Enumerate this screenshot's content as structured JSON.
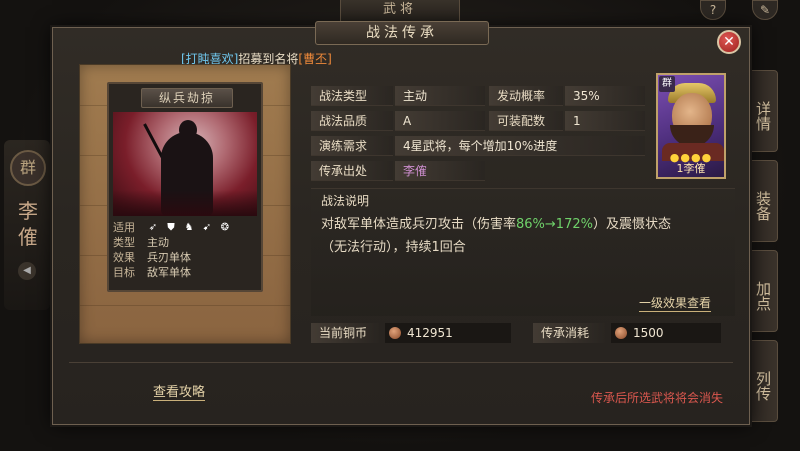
{
  "background": {
    "top_title": "武将",
    "top_buttons": [
      "?",
      "✎"
    ],
    "left_faction": "群",
    "left_name": "李傕",
    "side_tabs": [
      "详情",
      "装备",
      "加点",
      "列传"
    ]
  },
  "dialog": {
    "title": "战法传承",
    "close_icon": "close-icon",
    "recruit": {
      "player": "[打盹喜欢]",
      "text": "招募到名将",
      "hero": "[曹丕]"
    }
  },
  "card": {
    "name": "纵兵劫掠",
    "rows": [
      {
        "label": "适用",
        "icons": [
          "bow-icon",
          "shield-icon",
          "cavalry-icon",
          "spear-icon",
          "wheel-icon"
        ]
      },
      {
        "label": "类型",
        "value": "主动"
      },
      {
        "label": "效果",
        "value": "兵刃单体"
      },
      {
        "label": "目标",
        "value": "敌军单体"
      }
    ]
  },
  "info": {
    "type_label": "战法类型",
    "type_value": "主动",
    "rate_label": "发动概率",
    "rate_value": "35%",
    "quality_label": "战法品质",
    "quality_value": "A",
    "slots_label": "可装配数",
    "slots_value": "1",
    "req_label": "演练需求",
    "req_value": "4星武将，每个增加10%进度",
    "source_label": "传承出处",
    "source_value": "李傕"
  },
  "portrait": {
    "faction": "群",
    "stars": "●●●●",
    "level_name": "1李傕"
  },
  "description": {
    "title": "战法说明",
    "line1_pre": "对敌军单体造成兵刃攻击（伤害率",
    "line1_num": "86%→172%",
    "line1_post": "）及震慑状态",
    "line2": "（无法行动），持续1回合",
    "effect_link": "一级效果查看"
  },
  "currency": {
    "copper_label": "当前铜币",
    "copper_value": "412951",
    "cost_label": "传承消耗",
    "cost_value": "1500"
  },
  "footer": {
    "guide": "查看攻略",
    "warning": "传承后所选武将将会消失"
  }
}
